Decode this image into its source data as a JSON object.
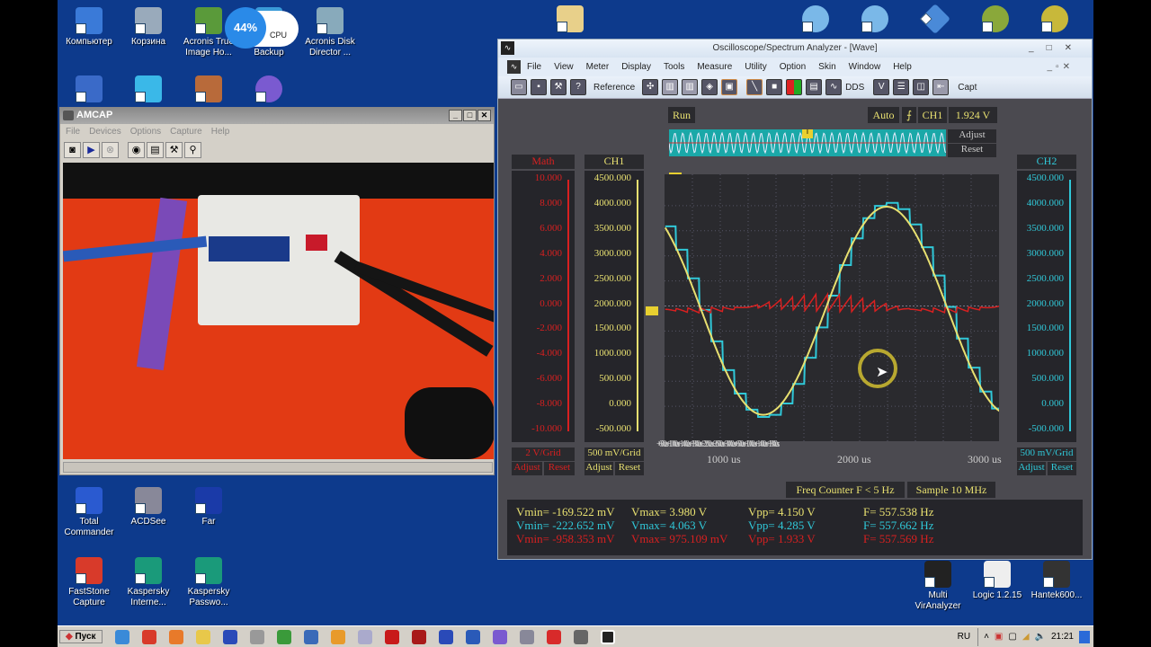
{
  "desktop": {
    "icons_top": [
      {
        "label": "Компьютер",
        "color": "#3a7ad8"
      },
      {
        "label": "Корзина",
        "color": "#9ab"
      },
      {
        "label": "Acronis True Image Ho...",
        "color": "#5a9a3a"
      },
      {
        "label": "Backup",
        "color": "#3a9ad8"
      },
      {
        "label": "Acronis Disk Director ...",
        "color": "#8ab"
      }
    ],
    "icons_bottom_left": [
      {
        "label": "Total Commander",
        "color": "#2a5ad0"
      },
      {
        "label": "ACDSee",
        "color": "#889"
      },
      {
        "label": "Far",
        "color": "#1a3aa8"
      },
      {
        "label": "FastStone Capture",
        "color": "#d83a2a"
      },
      {
        "label": "Kaspersky Interne...",
        "color": "#1a9a7a"
      },
      {
        "label": "Kaspersky Passwo...",
        "color": "#1a9a7a"
      }
    ],
    "icons_bottom_right": [
      {
        "label": "Multi VirAnalyzer",
        "color": "#222"
      },
      {
        "label": "Logic 1.2.15",
        "color": "#444"
      },
      {
        "label": "Hantek600...",
        "color": "#333"
      }
    ],
    "cpu_widget": {
      "percent": "44%",
      "label": "CPU"
    }
  },
  "amcap": {
    "title": "AMCAP",
    "menu": [
      "File",
      "Devices",
      "Options",
      "Capture",
      "Help"
    ]
  },
  "scope": {
    "title": "Oscilloscope/Spectrum Analyzer - [Wave]",
    "menu": [
      "File",
      "View",
      "Meter",
      "Display",
      "Tools",
      "Measure",
      "Utility",
      "Option",
      "Skin",
      "Window",
      "Help"
    ],
    "toolbar": {
      "reference": "Reference",
      "dds": "DDS",
      "capt": "Capt"
    },
    "run": "Run",
    "trigger_mode": "Auto",
    "trigger_source": "CH1",
    "trigger_level": "1.924 V",
    "adjust": "Adjust",
    "reset": "Reset",
    "math": {
      "title": "Math",
      "ticks": [
        "10.000",
        "8.000",
        "6.000",
        "4.000",
        "2.000",
        "0.000",
        "-2.000",
        "-4.000",
        "-6.000",
        "-8.000",
        "-10.000"
      ],
      "scale": "2 V/Grid",
      "color": "#d82020"
    },
    "ch1": {
      "title": "CH1",
      "ticks": [
        "4500.000",
        "4000.000",
        "3500.000",
        "3000.000",
        "2500.000",
        "2000.000",
        "1500.000",
        "1000.000",
        "500.000",
        "0.000",
        "-500.000"
      ],
      "scale": "500 mV/Grid",
      "color": "#e8e070"
    },
    "ch2": {
      "title": "CH2",
      "ticks": [
        "4500.000",
        "4000.000",
        "3500.000",
        "3000.000",
        "2500.000",
        "2000.000",
        "1500.000",
        "1000.000",
        "500.000",
        "0.000",
        "-500.000"
      ],
      "scale": "500 mV/Grid",
      "color": "#30c8d8"
    },
    "time_labels": [
      "1000 us",
      "2000 us",
      "3000 us"
    ],
    "freq_counter": "Freq Counter F < 5 Hz",
    "sample": "Sample 10 MHz",
    "measurements": [
      {
        "vmin": "Vmin= -169.522 mV",
        "vmax": "Vmax= 3.980 V",
        "vpp": "Vpp= 4.150 V",
        "f": "F= 557.538 Hz"
      },
      {
        "vmin": "Vmin= -222.652 mV",
        "vmax": "Vmax= 4.063 V",
        "vpp": "Vpp= 4.285 V",
        "f": "F= 557.662 Hz"
      },
      {
        "vmin": "Vmin= -958.353 mV",
        "vmax": "Vmax= 975.109 mV",
        "vpp": "Vpp= 1.933 V",
        "f": "F= 557.569 Hz"
      }
    ]
  },
  "chart_data": {
    "type": "line",
    "xlabel": "time (us)",
    "xlim": [
      600,
      3030
    ],
    "ylim_ch_mV": [
      -500,
      4500
    ],
    "ylim_math_V": [
      -10,
      10
    ],
    "series": [
      {
        "name": "CH1",
        "color": "#e8e070",
        "model": "sine",
        "offset_mV": 1905,
        "amplitude_mV": 2075,
        "freq_hz": 557.5,
        "peak_time_us": 2209
      },
      {
        "name": "CH2",
        "color": "#30c8d8",
        "model": "stepped-sine",
        "offset_mV": 1920,
        "amplitude_mV": 2140,
        "freq_hz": 557.7,
        "peak_time_us": 2195,
        "step_us": 85
      },
      {
        "name": "Math",
        "color": "#d82020",
        "model": "CH1-CH2",
        "offset_V": 0
      }
    ]
  },
  "taskbar": {
    "start": "Пуск",
    "lang": "RU",
    "clock": "21:21"
  }
}
